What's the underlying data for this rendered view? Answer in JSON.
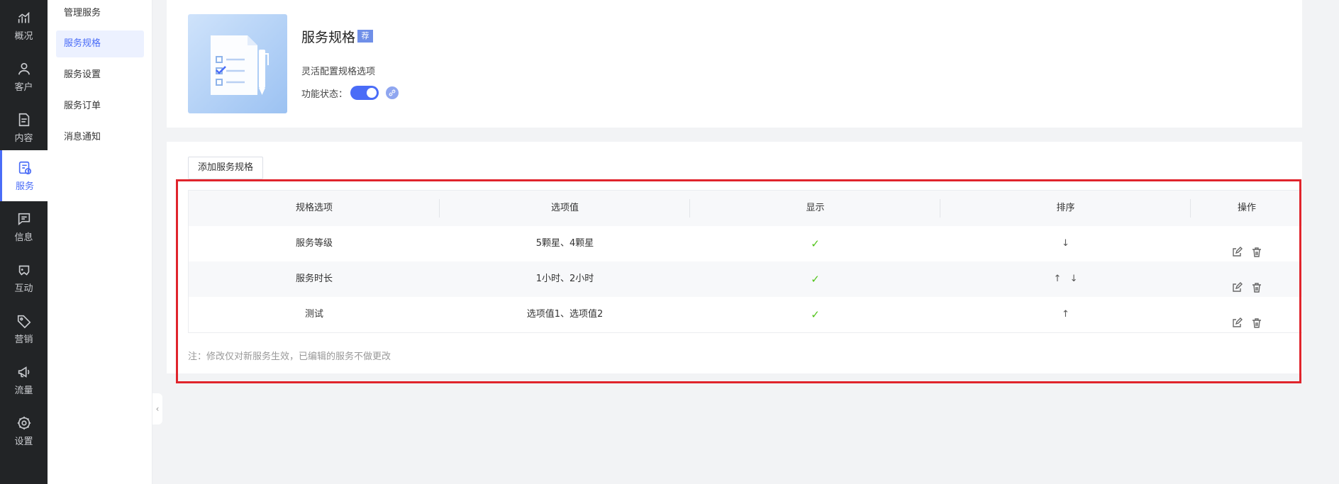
{
  "rail": {
    "items": [
      {
        "label": "概况",
        "icon": "chart-icon"
      },
      {
        "label": "客户",
        "icon": "user-icon"
      },
      {
        "label": "内容",
        "icon": "document-icon"
      },
      {
        "label": "服务",
        "icon": "service-icon",
        "active": true
      },
      {
        "label": "信息",
        "icon": "message-icon"
      },
      {
        "label": "互动",
        "icon": "gamepad-icon"
      },
      {
        "label": "营销",
        "icon": "tag-icon"
      },
      {
        "label": "流量",
        "icon": "megaphone-icon"
      },
      {
        "label": "设置",
        "icon": "gear-icon"
      }
    ]
  },
  "submenu": {
    "items": [
      {
        "label": "管理服务"
      },
      {
        "label": "服务规格",
        "active": true
      },
      {
        "label": "服务设置"
      },
      {
        "label": "服务订单"
      },
      {
        "label": "消息通知"
      }
    ]
  },
  "header": {
    "title": "服务规格",
    "badge": "荐",
    "description": "灵活配置规格选项",
    "status_label": "功能状态：",
    "status_on": true
  },
  "content": {
    "add_button": "添加服务规格",
    "table": {
      "columns": [
        "规格选项",
        "选项值",
        "显示",
        "排序",
        "操作"
      ],
      "rows": [
        {
          "name": "服务等级",
          "values": "5颗星、4颗星",
          "shown": true,
          "sort": [
            "↓"
          ]
        },
        {
          "name": "服务时长",
          "values": "1小时、2小时",
          "shown": true,
          "sort": [
            "↑",
            "↓"
          ]
        },
        {
          "name": "测试",
          "values": "选项值1、选项值2",
          "shown": true,
          "sort": [
            "↑"
          ]
        }
      ]
    },
    "note": "注：修改仅对新服务生效，已编辑的服务不做更改"
  },
  "colors": {
    "accent": "#4a6cf7",
    "rail_bg": "#222426",
    "highlight": "#e0242c",
    "check": "#52c41a"
  }
}
